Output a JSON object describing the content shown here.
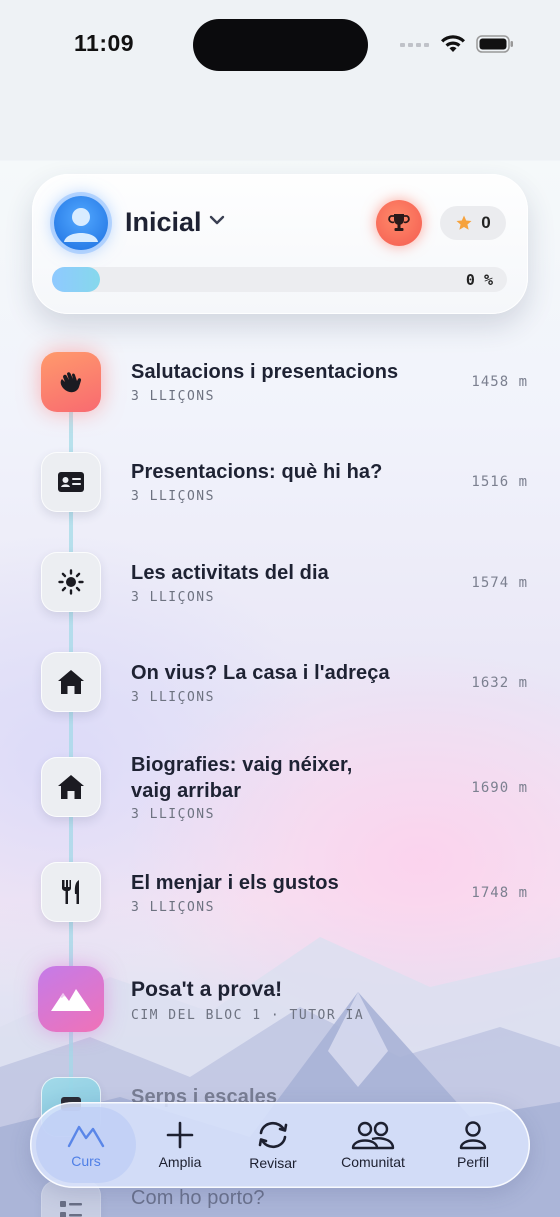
{
  "status_bar": {
    "time": "11:09"
  },
  "header": {
    "level": "Inicial",
    "stars": "0",
    "progress_label": "0 %",
    "progress_fraction": 0
  },
  "units": [
    {
      "title": "Salutacions i presentacions",
      "sub": "3 LLIÇONS",
      "dist": "1458 m",
      "icon": "waving-hand-icon"
    },
    {
      "title": "Presentacions: què hi ha?",
      "sub": "3 LLIÇONS",
      "dist": "1516 m",
      "icon": "id-card-icon"
    },
    {
      "title": "Les activitats del dia",
      "sub": "3 LLIÇONS",
      "dist": "1574 m",
      "icon": "sun-icon"
    },
    {
      "title": "On vius? La casa i l'adreça",
      "sub": "3 LLIÇONS",
      "dist": "1632 m",
      "icon": "house-icon"
    },
    {
      "title_line1": "Biografies: vaig néixer,",
      "title_line2": "vaig arribar",
      "sub": "3 LLIÇONS",
      "dist": "1690 m",
      "icon": "house-icon"
    },
    {
      "title": "El menjar i els gustos",
      "sub": "3 LLIÇONS",
      "dist": "1748 m",
      "icon": "fork-knife-icon"
    }
  ],
  "test": {
    "title": "Posa't a prova!",
    "sub": "CIM DEL BLOC 1 · TUTOR IA",
    "icon": "mountain-icon"
  },
  "partial_items": [
    {
      "title": "Serps i escales"
    },
    {
      "title": "Com ho porto?"
    }
  ],
  "tabs": [
    {
      "label": "Curs",
      "icon": "mountain-outline-icon"
    },
    {
      "label": "Amplia",
      "icon": "plus-icon"
    },
    {
      "label": "Revisar",
      "icon": "refresh-icon"
    },
    {
      "label": "Comunitat",
      "icon": "people-icon"
    },
    {
      "label": "Perfil",
      "icon": "person-icon"
    }
  ],
  "colors": {
    "accent": "#4f7fe6",
    "trophy": "#f45b50",
    "progress": "#8fc9ff",
    "test_gradient": "#c47be9"
  }
}
